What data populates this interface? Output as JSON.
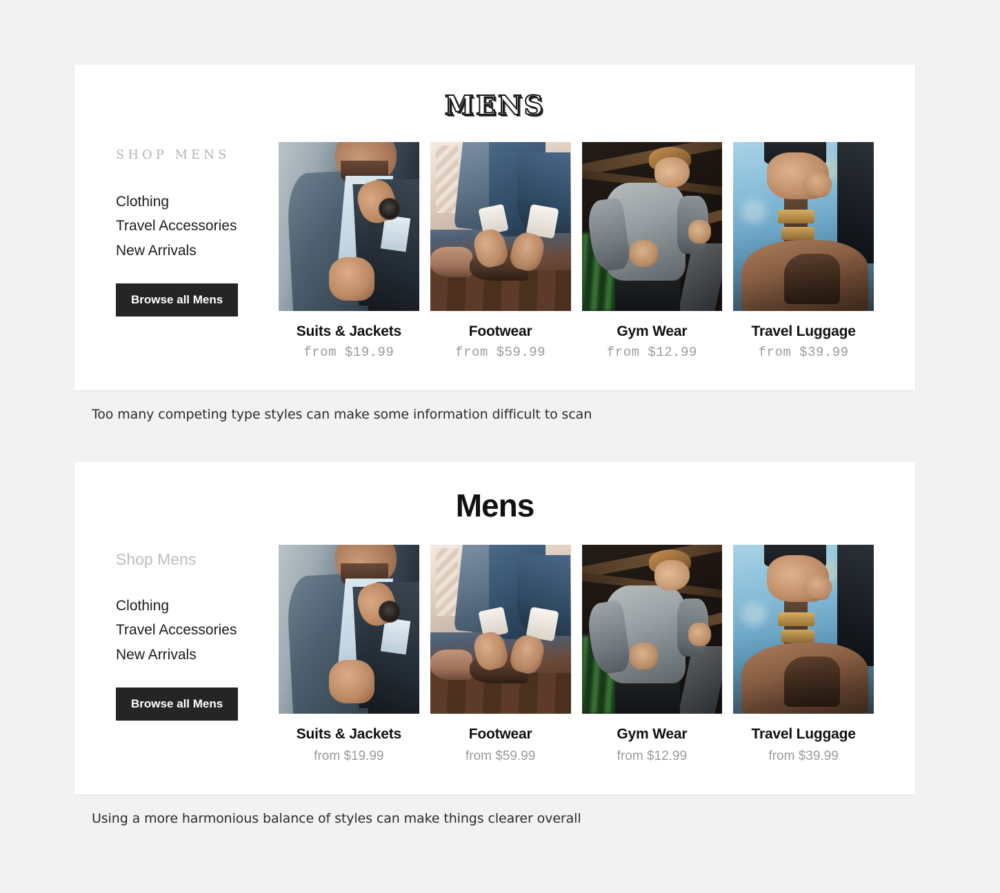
{
  "examples": [
    {
      "id": "clashing",
      "title": "MENS",
      "sidebar": {
        "heading": "SHOP MENS",
        "links": [
          "Clothing",
          "Travel Accessories",
          "New Arrivals"
        ],
        "button": "Browse all Mens"
      },
      "products": [
        {
          "name": "Suits & Jackets",
          "price": "from $19.99",
          "image": "man-in-blue-suit-adjusting-tie"
        },
        {
          "name": "Footwear",
          "price": "from $59.99",
          "image": "man-tying-brown-dress-shoes"
        },
        {
          "name": "Gym Wear",
          "price": "from $12.99",
          "image": "man-running-in-gray-compression-shirt"
        },
        {
          "name": "Travel Luggage",
          "price": "from $39.99",
          "image": "hand-holding-leather-bag-strap"
        }
      ],
      "caption": "Too many competing type styles can make some information difficult to scan"
    },
    {
      "id": "harmonious",
      "title": "Mens",
      "sidebar": {
        "heading": "Shop Mens",
        "links": [
          "Clothing",
          "Travel Accessories",
          "New Arrivals"
        ],
        "button": "Browse all Mens"
      },
      "products": [
        {
          "name": "Suits & Jackets",
          "price": "from $19.99",
          "image": "man-in-blue-suit-adjusting-tie"
        },
        {
          "name": "Footwear",
          "price": "from $59.99",
          "image": "man-tying-brown-dress-shoes"
        },
        {
          "name": "Gym Wear",
          "price": "from $12.99",
          "image": "man-running-in-gray-compression-shirt"
        },
        {
          "name": "Travel Luggage",
          "price": "from $39.99",
          "image": "hand-holding-leather-bag-strap"
        }
      ],
      "caption": "Using a more harmonious balance of styles can make things clearer overall"
    }
  ],
  "colors": {
    "page_background": "#f2f2f2",
    "card_background": "#ffffff",
    "text": "#111111",
    "muted_text": "#9b9b9b",
    "heading_muted": "#b4b4b4",
    "button_background": "#252525",
    "button_text": "#ffffff"
  }
}
